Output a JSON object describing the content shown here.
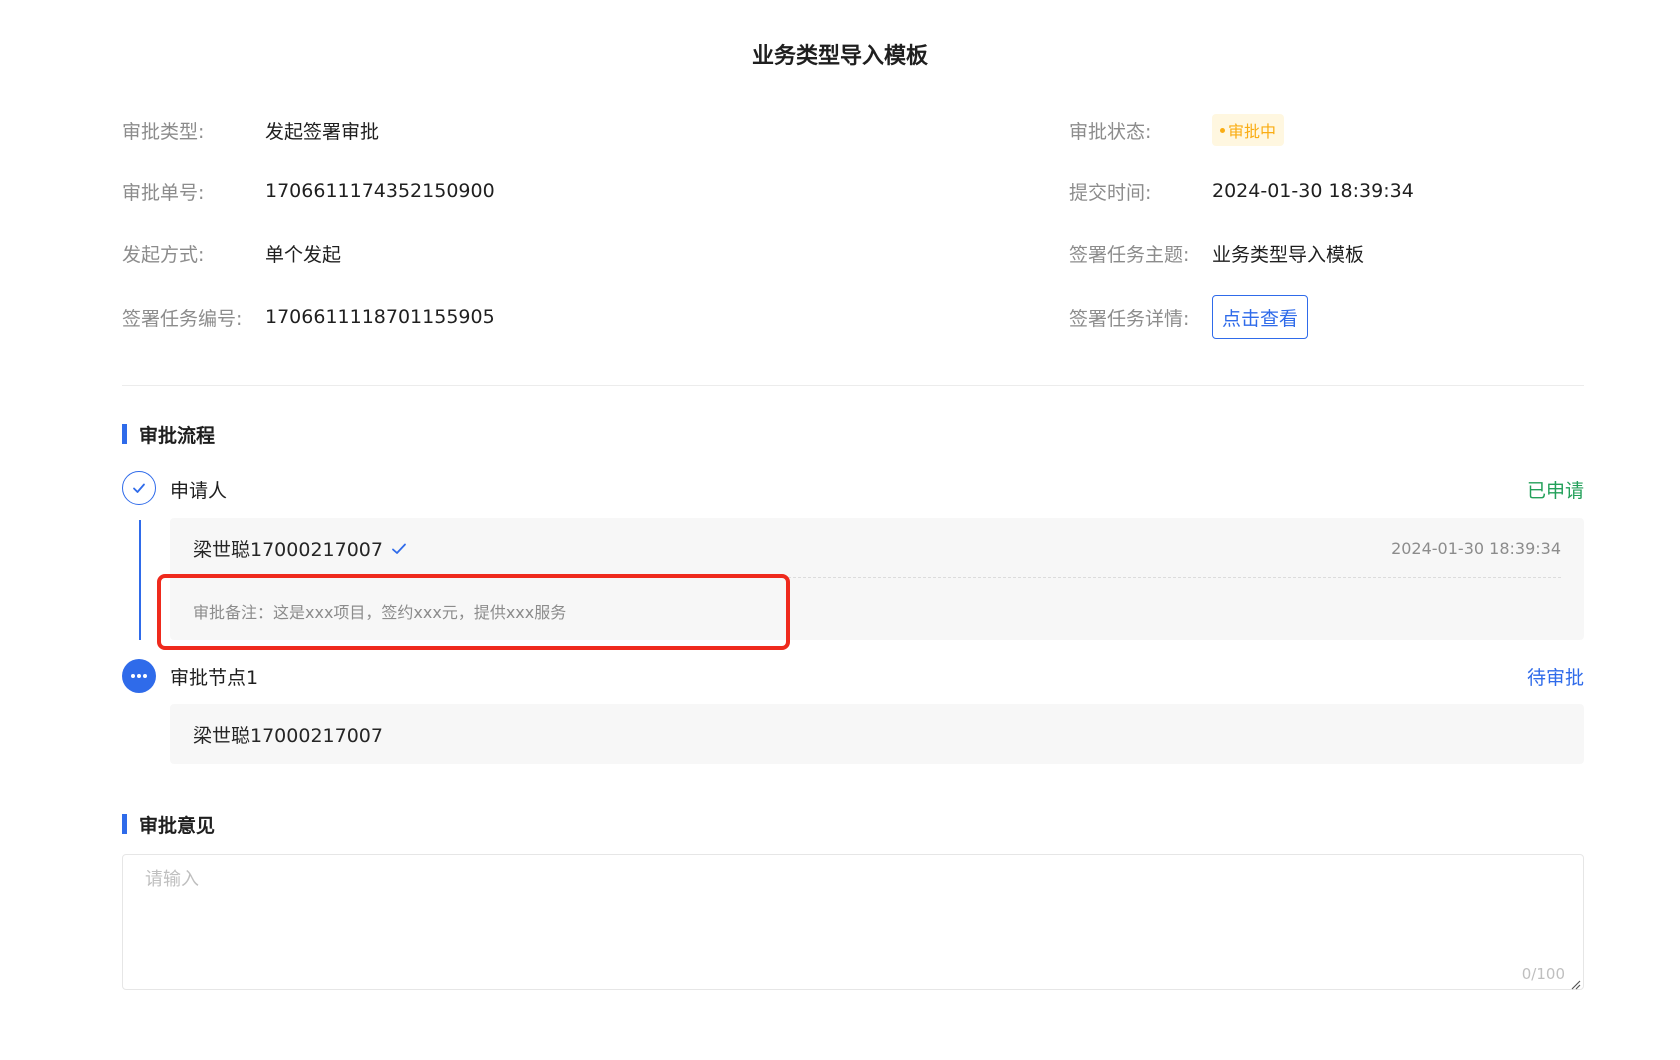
{
  "title": "业务类型导入模板",
  "info_left": [
    {
      "label": "审批类型:",
      "value": "发起签署审批"
    },
    {
      "label": "审批单号:",
      "value": "1706611174352150900"
    },
    {
      "label": "发起方式:",
      "value": "单个发起"
    },
    {
      "label": "签署任务编号:",
      "value": "1706611118701155905"
    }
  ],
  "info_right": {
    "status": {
      "label": "审批状态:",
      "value": "审批中"
    },
    "submit_time": {
      "label": "提交时间:",
      "value": "2024-01-30 18:39:34"
    },
    "subject": {
      "label": "签署任务主题:",
      "value": "业务类型导入模板"
    },
    "detail": {
      "label": "签署任务详情:",
      "button": "点击查看"
    }
  },
  "process": {
    "title": "审批流程",
    "steps": [
      {
        "name": "申请人",
        "status": "已申请",
        "icon": "check-circle-icon",
        "user": "梁世聪17000217007",
        "time": "2024-01-30 18:39:34",
        "remark": "审批备注：这是xxx项目，签约xxx元，提供xxx服务"
      },
      {
        "name": "审批节点1",
        "status": "待审批",
        "icon": "more-circle-icon",
        "user": "梁世聪17000217007"
      }
    ]
  },
  "opinion": {
    "title": "审批意见",
    "placeholder": "请输入",
    "count": "0/100"
  },
  "colors": {
    "primary": "#2f6bea",
    "success": "#23a05a",
    "warning": "#faad14",
    "highlight": "#ef2a1d"
  }
}
